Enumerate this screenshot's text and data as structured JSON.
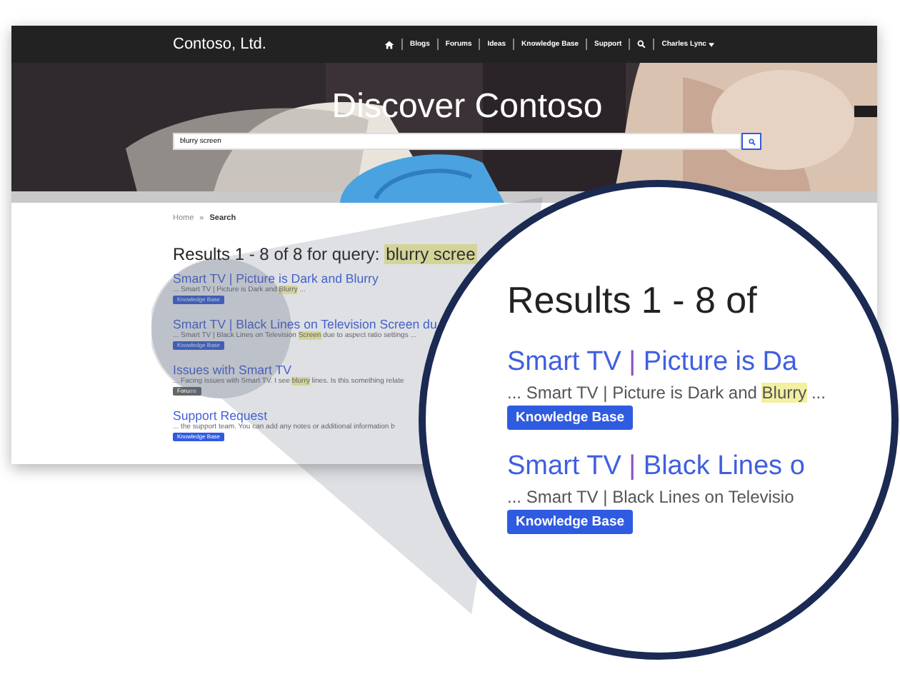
{
  "nav": {
    "brand": "Contoso, Ltd.",
    "links": [
      {
        "label": "Blogs"
      },
      {
        "label": "Forums"
      },
      {
        "label": "Ideas"
      },
      {
        "label": "Knowledge Base"
      },
      {
        "label": "Support"
      }
    ],
    "user": "Charles Lync"
  },
  "hero": {
    "title": "Discover Contoso",
    "search": {
      "value": "blurry screen"
    }
  },
  "breadcrumb": {
    "separator": "»",
    "items": [
      {
        "label": "Home",
        "current": false
      },
      {
        "label": "Search",
        "current": true
      }
    ]
  },
  "results": {
    "summary": "Results 1 - 8 of 8 for query:",
    "query": "blurry scree",
    "items": [
      {
        "title": "Smart TV | Picture is Dark and Blurry",
        "snippet": {
          "before": "... Smart TV | Picture is Dark and ",
          "highlight": "Blurry",
          "after": " ..."
        },
        "tag": {
          "label": "Knowledge Base",
          "kind": "kb"
        }
      },
      {
        "title": "Smart TV | Black Lines on Television Screen du",
        "snippet": {
          "before": "... Smart TV | Black Lines on Television ",
          "highlight": "Screen",
          "after": " due to aspect ratio settings ..."
        },
        "tag": {
          "label": "Knowledge Base",
          "kind": "kb"
        }
      },
      {
        "title": "Issues with Smart TV",
        "snippet": {
          "before": "... Facing issues with Smart TV. I see ",
          "highlight": "blurry",
          "after": " lines. Is this something relate"
        },
        "tag": {
          "label": "Forums",
          "kind": "forum"
        }
      },
      {
        "title": "Support Request",
        "snippet": {
          "before": "... the support team. You can add any notes or additional information b"
        },
        "tag": {
          "label": "Knowledge Base",
          "kind": "kb"
        }
      }
    ]
  },
  "magnifier": {
    "summary": "Results 1 - 8 of",
    "items": [
      {
        "title": [
          "Smart TV",
          "|",
          "Picture is Da"
        ],
        "snippet": {
          "before": "... Smart TV | Picture is Dark and ",
          "highlight": "Blurry",
          "after": " ..."
        },
        "tag": {
          "label": "Knowledge Base",
          "kind": "kb"
        }
      },
      {
        "title": [
          "Smart TV",
          "|",
          "Black Lines o"
        ],
        "snippet": {
          "before": "... Smart TV | Black Lines on Televisio"
        },
        "tag": {
          "label": "Knowledge Base",
          "kind": "kb"
        }
      }
    ]
  }
}
